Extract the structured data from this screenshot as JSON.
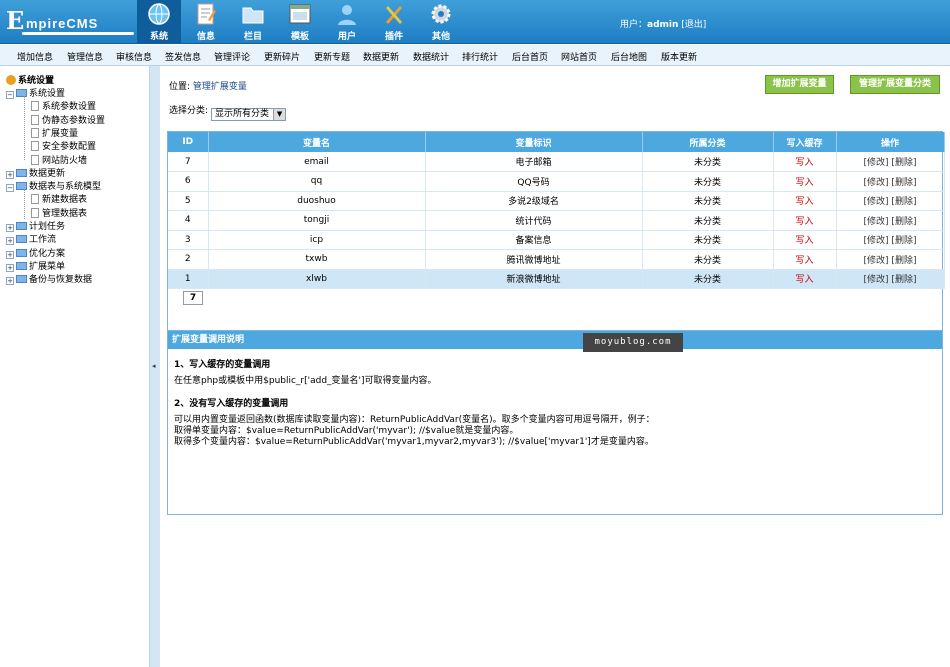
{
  "logo": {
    "big": "E",
    "rest": "mpireCMS"
  },
  "topnav": [
    {
      "label": "系统",
      "icon": "globe-icon",
      "active": true
    },
    {
      "label": "信息",
      "icon": "document-icon",
      "active": false
    },
    {
      "label": "栏目",
      "icon": "folder-icon",
      "active": false
    },
    {
      "label": "模板",
      "icon": "window-icon",
      "active": false
    },
    {
      "label": "用户",
      "icon": "user-icon",
      "active": false
    },
    {
      "label": "插件",
      "icon": "tools-icon",
      "active": false
    },
    {
      "label": "其他",
      "icon": "gear-icon",
      "active": false
    }
  ],
  "user": {
    "prefix": "用户：",
    "name": "admin",
    "logout": "[退出]"
  },
  "subnav": [
    "增加信息",
    "管理信息",
    "审核信息",
    "签发信息",
    "管理评论",
    "更新碎片",
    "更新专题",
    "数据更新",
    "数据统计",
    "排行统计",
    "后台首页",
    "网站首页",
    "后台地图",
    "版本更新"
  ],
  "tree": {
    "root": "系统设置",
    "items": [
      {
        "label": "系统设置",
        "level": 1,
        "sign": "−"
      },
      {
        "label": "系统参数设置",
        "level": 2
      },
      {
        "label": "伪静态参数设置",
        "level": 2
      },
      {
        "label": "扩展变量",
        "level": 2
      },
      {
        "label": "安全参数配置",
        "level": 2
      },
      {
        "label": "网站防火墙",
        "level": 2
      },
      {
        "label": "数据更新",
        "level": 1,
        "sign": "+"
      },
      {
        "label": "数据表与系统模型",
        "level": 1,
        "sign": "−"
      },
      {
        "label": "新建数据表",
        "level": 2
      },
      {
        "label": "管理数据表",
        "level": 2
      },
      {
        "label": "计划任务",
        "level": 1,
        "sign": "+"
      },
      {
        "label": "工作流",
        "level": 1,
        "sign": "+"
      },
      {
        "label": "优化方案",
        "level": 1,
        "sign": "+"
      },
      {
        "label": "扩展菜单",
        "level": 1,
        "sign": "+"
      },
      {
        "label": "备份与恢复数据",
        "level": 1,
        "sign": "+"
      }
    ]
  },
  "splitter": "◂",
  "location": {
    "prefix": "位置: ",
    "link": "管理扩展变量"
  },
  "buttons": {
    "add": "增加扩展变量",
    "manage": "管理扩展变量分类"
  },
  "filter": {
    "label": "选择分类:",
    "value": "显示所有分类",
    "arrow": "▼"
  },
  "table": {
    "headers": [
      "ID",
      "变量名",
      "变量标识",
      "所属分类",
      "写入缓存",
      "操作"
    ],
    "rows": [
      {
        "id": "7",
        "name": "email",
        "title": "电子邮箱",
        "cat": "未分类",
        "cache": "写入",
        "ops": "[修改] [删除]"
      },
      {
        "id": "6",
        "name": "qq",
        "title": "QQ号码",
        "cat": "未分类",
        "cache": "写入",
        "ops": "[修改] [删除]"
      },
      {
        "id": "5",
        "name": "duoshuo",
        "title": "多说2级域名",
        "cat": "未分类",
        "cache": "写入",
        "ops": "[修改] [删除]"
      },
      {
        "id": "4",
        "name": "tongji",
        "title": "统计代码",
        "cat": "未分类",
        "cache": "写入",
        "ops": "[修改] [删除]"
      },
      {
        "id": "3",
        "name": "icp",
        "title": "备案信息",
        "cat": "未分类",
        "cache": "写入",
        "ops": "[修改] [删除]"
      },
      {
        "id": "2",
        "name": "txwb",
        "title": "腾讯微博地址",
        "cat": "未分类",
        "cache": "写入",
        "ops": "[修改] [删除]"
      },
      {
        "id": "1",
        "name": "xlwb",
        "title": "新浪微博地址",
        "cat": "未分类",
        "cache": "写入",
        "ops": "[修改] [删除]"
      }
    ],
    "pager": "7"
  },
  "help": {
    "title": "扩展变量调用说明",
    "s1_title": "1、写入缓存的变量调用",
    "s1_text": "在任意php或模板中用$public_r['add_变量名']可取得变量内容。",
    "s2_title": "2、没有写入缓存的变量调用",
    "s2_line1": "可以用内置变量返回函数(数据库读取变量内容)：ReturnPublicAddVar(变量名)。取多个变量内容可用逗号隔开，例子：",
    "s2_line2": "取得单变量内容：$value=ReturnPublicAddVar('myvar'); //$value就是变量内容。",
    "s2_line3": "取得多个变量内容：$value=ReturnPublicAddVar('myvar1,myvar2,myvar3'); //$value['myvar1']才是变量内容。"
  },
  "watermark": "moyublog.com"
}
